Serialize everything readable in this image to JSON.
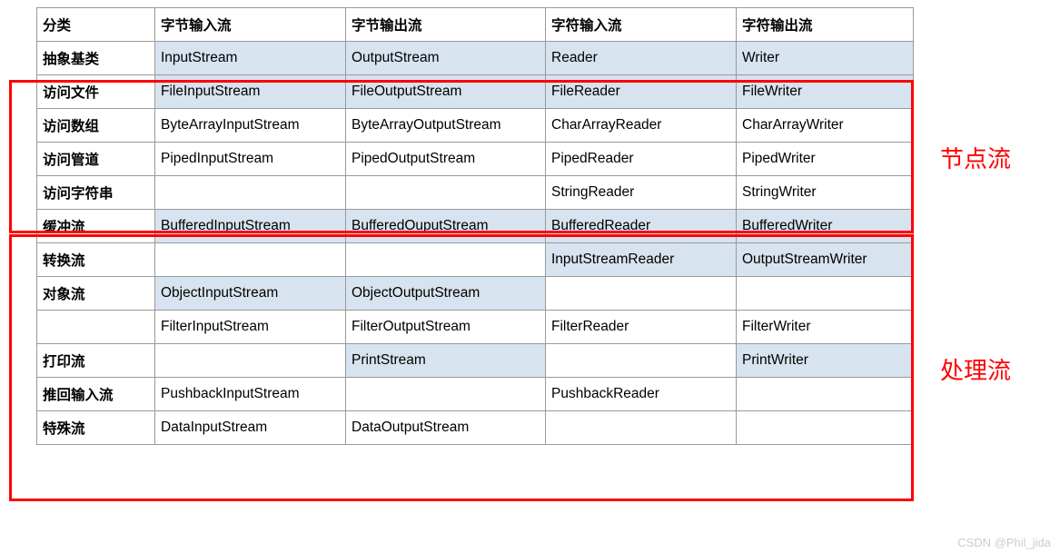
{
  "headers": [
    "分类",
    "字节输入流",
    "字节输出流",
    "字符输入流",
    "字符输出流"
  ],
  "rows": [
    {
      "cat": "抽象基类",
      "c": [
        "InputStream",
        "OutputStream",
        "Reader",
        "Writer"
      ],
      "hl": [
        1,
        2,
        3,
        4
      ]
    },
    {
      "cat": "访问文件",
      "c": [
        "FileInputStream",
        "FileOutputStream",
        "FileReader",
        "FileWriter"
      ],
      "hl": [
        1,
        2,
        3,
        4
      ]
    },
    {
      "cat": "访问数组",
      "c": [
        "ByteArrayInputStream",
        "ByteArrayOutputStream",
        "CharArrayReader",
        "CharArrayWriter"
      ],
      "hl": []
    },
    {
      "cat": "访问管道",
      "c": [
        "PipedInputStream",
        "PipedOutputStream",
        "PipedReader",
        "PipedWriter"
      ],
      "hl": []
    },
    {
      "cat": "访问字符串",
      "c": [
        "",
        "",
        "StringReader",
        "StringWriter"
      ],
      "hl": []
    },
    {
      "cat": "缓冲流",
      "c": [
        "BufferedInputStream",
        "BufferedOuputStream",
        "BufferedReader",
        "BufferedWriter"
      ],
      "hl": [
        1,
        2,
        3,
        4
      ]
    },
    {
      "cat": "转换流",
      "c": [
        "",
        "",
        "InputStreamReader",
        "OutputStreamWriter"
      ],
      "hl": [
        3,
        4
      ]
    },
    {
      "cat": "对象流",
      "c": [
        "ObjectInputStream",
        "ObjectOutputStream",
        "",
        ""
      ],
      "hl": [
        1,
        2
      ]
    },
    {
      "cat": "",
      "c": [
        "FilterInputStream",
        "FilterOutputStream",
        "FilterReader",
        "FilterWriter"
      ],
      "hl": []
    },
    {
      "cat": "打印流",
      "c": [
        "",
        "PrintStream",
        "",
        "PrintWriter"
      ],
      "hl": [
        2,
        4
      ]
    },
    {
      "cat": "推回输入流",
      "c": [
        "PushbackInputStream",
        "",
        "PushbackReader",
        ""
      ],
      "hl": []
    },
    {
      "cat": "特殊流",
      "c": [
        "DataInputStream",
        "DataOutputStream",
        "",
        ""
      ],
      "hl": []
    }
  ],
  "captions": {
    "node_stream": "节点流",
    "process_stream": "处理流"
  },
  "watermark": "CSDN @Phil_jida"
}
